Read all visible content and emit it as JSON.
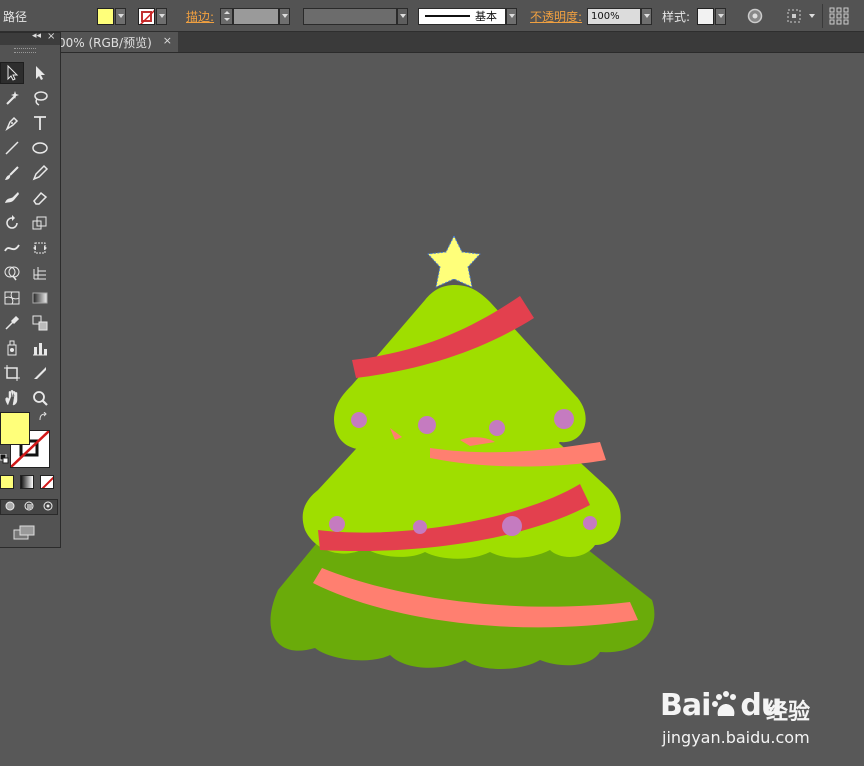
{
  "control_bar": {
    "object_type": "路径",
    "fill_color": "#ffff7a",
    "stroke_label": "描边:",
    "opacity_label": "不透明度:",
    "opacity_value": "100%",
    "stroke_profile_label": "基本",
    "style_label": "样式:"
  },
  "document_tab": {
    "title": "00% (RGB/预览)",
    "close_glyph": "×"
  },
  "tool_panel": {
    "collapse_glyph": "◂◂",
    "close_glyph": "×",
    "tools": [
      "selection-tool",
      "direct-selection-tool",
      "magic-wand-tool",
      "lasso-tool",
      "pen-tool",
      "type-tool",
      "line-tool",
      "ellipse-tool",
      "paintbrush-tool",
      "pencil-tool",
      "blob-brush-tool",
      "eraser-tool",
      "rotate-tool",
      "scale-tool",
      "warp-tool",
      "free-transform-tool",
      "shape-builder-tool",
      "perspective-grid-tool",
      "mesh-tool",
      "gradient-tool",
      "eyedropper-tool",
      "blend-tool",
      "symbol-sprayer-tool",
      "column-graph-tool",
      "artboard-tool",
      "slice-tool",
      "hand-tool",
      "zoom-tool"
    ],
    "fill_color": "#ffff7a"
  },
  "illustration": {
    "tree_dark_green": "#6aab0a",
    "tree_light_green": "#9fde00",
    "ribbon_red": "#e3404e",
    "ribbon_salmon": "#ff7f70",
    "ornament_purple": "#c57bc0",
    "star_yellow": "#ffff7a"
  },
  "watermark": {
    "brand": "Bai",
    "brand_suffix": "du",
    "product": "经验",
    "url": "jingyan.baidu.com"
  }
}
